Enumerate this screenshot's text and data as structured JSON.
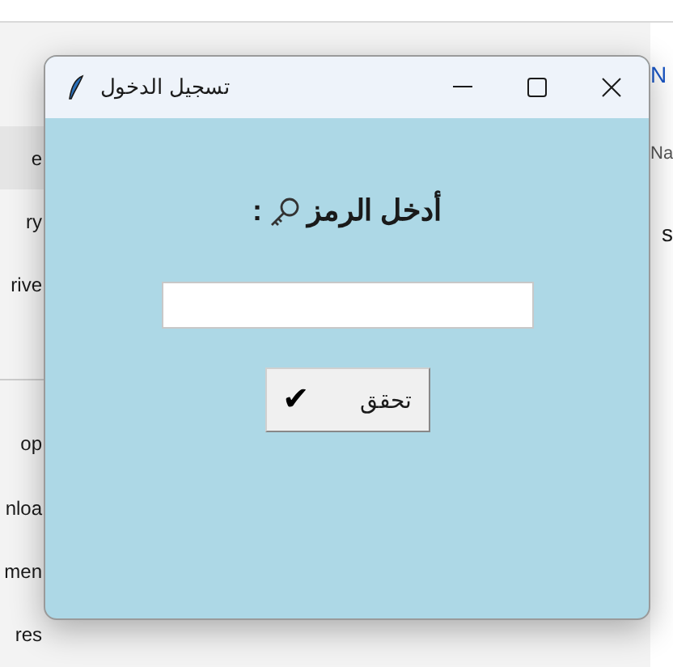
{
  "background_window": {
    "sidebar_items": [
      {
        "label": "e",
        "selected": true
      },
      {
        "label": "ry",
        "selected": false
      },
      {
        "label": "rive",
        "selected": false
      },
      {
        "label": "op",
        "selected": false
      },
      {
        "label": "nloa",
        "selected": false
      },
      {
        "label": "men",
        "selected": false
      },
      {
        "label": "res",
        "selected": false
      }
    ],
    "toolbar_text": "N",
    "column_header": "Na",
    "files": [
      "s"
    ]
  },
  "dialog": {
    "title": "تسجيل الدخول",
    "prompt": "أدخل الرمز",
    "prompt_suffix": ":",
    "button": {
      "label": "تحقق",
      "mark": "✔"
    }
  }
}
